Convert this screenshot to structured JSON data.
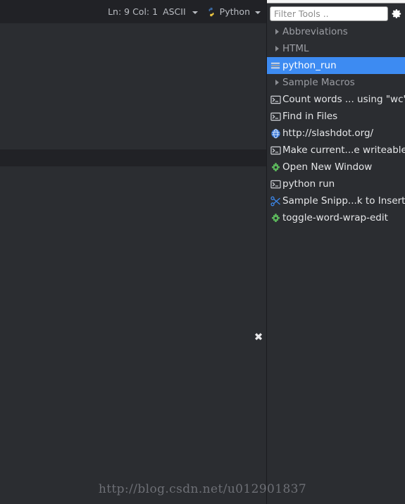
{
  "status_bar": {
    "line_col": "Ln: 9 Col: 1",
    "encoding": "ASCII",
    "encoding_caret_icon": "chevron-down-icon",
    "language_icon": "python-logo-icon",
    "language": "Python",
    "language_caret_icon": "chevron-down-icon"
  },
  "editor": {
    "close_overlay_label": "✖",
    "close_overlay_icon": "close-icon"
  },
  "tools_panel": {
    "filter": {
      "placeholder": "Filter Tools ..",
      "value": ""
    },
    "gear_icon": "gear-icon",
    "gear_caret_icon": "chevron-down-icon",
    "items": [
      {
        "label": "Abbreviations",
        "icon": "chevron-right-icon",
        "type": "group",
        "selected": false
      },
      {
        "label": "HTML",
        "icon": "chevron-right-icon",
        "type": "group",
        "selected": false
      },
      {
        "label": "python_run",
        "icon": "folder-list-icon",
        "type": "folder",
        "selected": true
      },
      {
        "label": "Sample Macros",
        "icon": "chevron-right-icon",
        "type": "group",
        "selected": false
      },
      {
        "label": "Count words ... using \"wc\"",
        "icon": "console-icon",
        "type": "command",
        "selected": false
      },
      {
        "label": "Find in Files",
        "icon": "console-icon",
        "type": "command",
        "selected": false
      },
      {
        "label": "http://slashdot.org/",
        "icon": "globe-icon",
        "type": "url",
        "selected": false
      },
      {
        "label": "Make current...e writeable",
        "icon": "console-icon",
        "type": "command",
        "selected": false
      },
      {
        "label": "Open New Window",
        "icon": "macro-icon",
        "type": "macro",
        "selected": false
      },
      {
        "label": "python run",
        "icon": "console-icon",
        "type": "command",
        "selected": false
      },
      {
        "label": "Sample Snipp...k to Insert",
        "icon": "scissors-icon",
        "type": "snippet",
        "selected": false
      },
      {
        "label": "toggle-word-wrap-edit",
        "icon": "macro-icon",
        "type": "macro",
        "selected": false
      }
    ]
  },
  "watermark": {
    "text": "http://blog.csdn.net/u012901837"
  },
  "colors": {
    "panel_background": "#2b2d31",
    "status_bar_background": "#212226",
    "selection_blue": "#3d8bf2",
    "group_text": "#9b9da3",
    "item_text": "#e6e7e9",
    "macro_green": "#5cb85c",
    "snippet_blue": "#3d8bf2",
    "globe_blue": "#2f6fd0"
  }
}
